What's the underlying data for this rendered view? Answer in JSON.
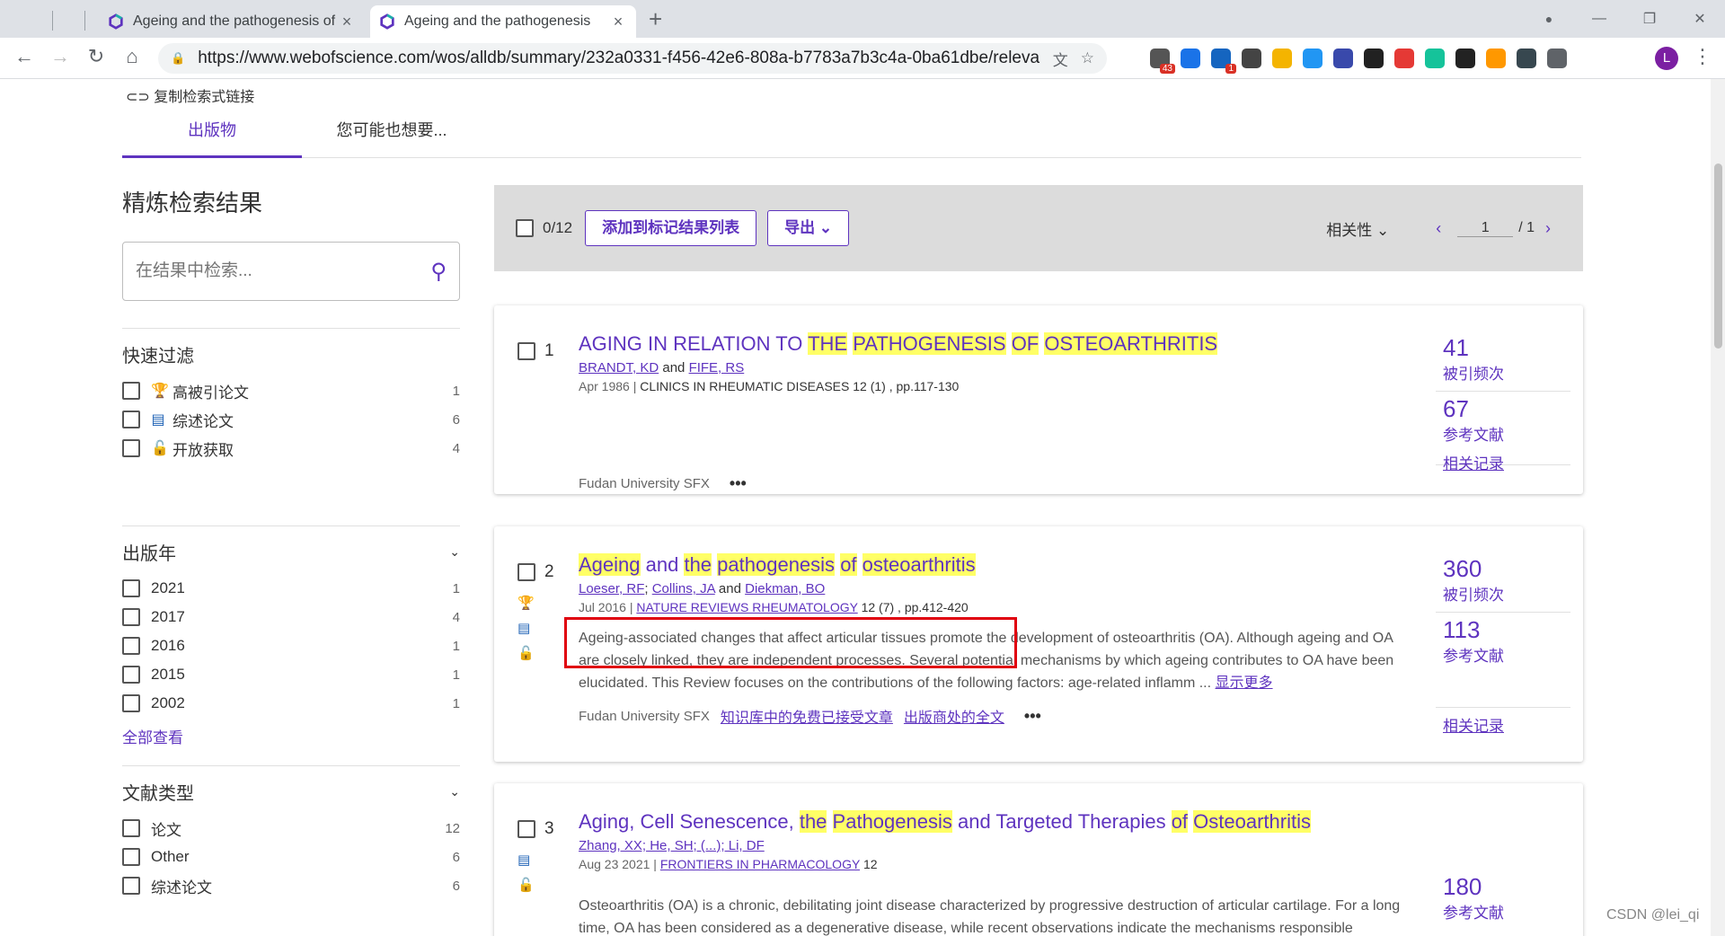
{
  "browser": {
    "tabs": [
      {
        "title": "Ageing and the pathogenesis of",
        "active": false,
        "close": "×"
      },
      {
        "title": "Ageing and the pathogenesis",
        "active": true,
        "close": "×"
      }
    ],
    "new_tab": "+",
    "window_controls": [
      "—",
      "❐",
      "✕"
    ],
    "url": "https://www.webofscience.com/wos/alldb/summary/232a0331-f456-42e6-808a-b7783a7b3c4a-0ba61dbe/releva...",
    "extensions": [
      {
        "name": "grid-extension",
        "color": "#555",
        "badge": "43"
      },
      {
        "name": "vpn-extension",
        "color": "#1a73e8",
        "badge": ""
      },
      {
        "name": "warning-extension",
        "color": "#1565c0",
        "badge": "1"
      },
      {
        "name": "clock-extension",
        "color": "#444",
        "badge": ""
      },
      {
        "name": "folder-extension",
        "color": "#f4b400",
        "badge": ""
      },
      {
        "name": "blue-note-extension",
        "color": "#2196f3",
        "badge": ""
      },
      {
        "name": "star-box-extension",
        "color": "#3949ab",
        "badge": ""
      },
      {
        "name": "face-extension",
        "color": "#212121",
        "badge": ""
      },
      {
        "name": "weibo-extension",
        "color": "#e53935",
        "badge": ""
      },
      {
        "name": "grammarly-extension",
        "color": "#15c39a",
        "badge": ""
      },
      {
        "name": "infinity-extension",
        "color": "#222",
        "badge": ""
      },
      {
        "name": "fish-extension",
        "color": "#ff9800",
        "badge": ""
      },
      {
        "name": "gear-extension",
        "color": "#37474f",
        "badge": ""
      },
      {
        "name": "puzzle-extension",
        "color": "#5f6368",
        "badge": ""
      }
    ],
    "avatar_letter": "L"
  },
  "page": {
    "copy_link": "复制检索式链接",
    "tabs": [
      "出版物",
      "您可能也想要..."
    ],
    "refine": {
      "title": "精炼检索结果",
      "search_placeholder": "在结果中检索...",
      "quick_filter_title": "快速过滤",
      "quick_filters": [
        {
          "label": "高被引论文",
          "count": "1",
          "icon": "trophy-icon"
        },
        {
          "label": "综述论文",
          "count": "6",
          "icon": "document-icon"
        },
        {
          "label": "开放获取",
          "count": "4",
          "icon": "lock-icon"
        }
      ],
      "year_title": "出版年",
      "years": [
        {
          "label": "2021",
          "count": "1"
        },
        {
          "label": "2017",
          "count": "4"
        },
        {
          "label": "2016",
          "count": "1"
        },
        {
          "label": "2015",
          "count": "1"
        },
        {
          "label": "2002",
          "count": "1"
        }
      ],
      "see_all": "全部查看",
      "doctype_title": "文献类型",
      "doctypes": [
        {
          "label": "论文",
          "count": "12"
        },
        {
          "label": "Other",
          "count": "6"
        },
        {
          "label": "综述论文",
          "count": "6"
        }
      ]
    },
    "toolbar": {
      "selected": "0/12",
      "add_to_list": "添加到标记结果列表",
      "export": "导出",
      "sort": "相关性",
      "page": "1",
      "total_pages": "/ 1"
    },
    "results": [
      {
        "index": "1",
        "title_parts": [
          {
            "t": "AGING IN RELATION TO ",
            "h": false
          },
          {
            "t": "THE",
            "h": true
          },
          {
            "t": " ",
            "h": false
          },
          {
            "t": "PATHOGENESIS",
            "h": true
          },
          {
            "t": " ",
            "h": false
          },
          {
            "t": "OF",
            "h": true
          },
          {
            "t": " ",
            "h": false
          },
          {
            "t": "OSTEOARTHRITIS",
            "h": true
          }
        ],
        "authors": [
          "BRANDT, KD",
          "FIFE, RS"
        ],
        "date": "Apr 1986",
        "source": "CLINICS IN RHEUMATIC DISEASES",
        "source_link": false,
        "volume": "12 (1) , pp.117-130",
        "citations": "41",
        "citations_label": "被引频次",
        "references": "67",
        "references_label": "参考文献",
        "sfx": "Fudan University SFX",
        "related": "相关记录"
      },
      {
        "index": "2",
        "title_parts": [
          {
            "t": "Ageing",
            "h": true
          },
          {
            "t": " and ",
            "h": false
          },
          {
            "t": "the",
            "h": true
          },
          {
            "t": " ",
            "h": false
          },
          {
            "t": "pathogenesis",
            "h": true
          },
          {
            "t": " ",
            "h": false
          },
          {
            "t": "of",
            "h": true
          },
          {
            "t": " ",
            "h": false
          },
          {
            "t": "osteoarthritis",
            "h": true
          }
        ],
        "authors": [
          "Loeser, RF",
          "Collins, JA",
          "Diekman, BO"
        ],
        "date": "Jul 2016",
        "source": "NATURE REVIEWS RHEUMATOLOGY",
        "source_link": true,
        "volume": "12 (7) , pp.412-420",
        "abstract": "Ageing-associated changes that affect articular tissues promote the development of osteoarthritis (OA). Although ageing and OA are closely linked, they are independent processes. Several potential mechanisms by which ageing contributes to OA have been elucidated. This Review focuses on the contributions of the following factors: age-related inflamm ...",
        "show_more": "显示更多",
        "citations": "360",
        "citations_label": "被引频次",
        "references": "113",
        "references_label": "参考文献",
        "sfx": "Fudan University SFX",
        "free_link": "知识库中的免费已接受文章",
        "publisher_link": "出版商处的全文",
        "related": "相关记录"
      },
      {
        "index": "3",
        "title_parts": [
          {
            "t": "Aging, Cell Senescence, ",
            "h": false
          },
          {
            "t": "the",
            "h": true
          },
          {
            "t": " ",
            "h": false
          },
          {
            "t": "Pathogenesis",
            "h": true
          },
          {
            "t": " and Targeted Therapies ",
            "h": false
          },
          {
            "t": "of",
            "h": true
          },
          {
            "t": " ",
            "h": false
          },
          {
            "t": "Osteoarthritis",
            "h": true
          }
        ],
        "authors_text": "Zhang, XX; He, SH; (...); Li, DF",
        "date": "Aug 23 2021",
        "source": "FRONTIERS IN PHARMACOLOGY",
        "source_link": true,
        "volume": "12",
        "abstract": "Osteoarthritis (OA) is a chronic, debilitating joint disease characterized by progressive destruction of articular cartilage. For a long time, OA has been considered as a degenerative disease, while recent observations indicate the mechanisms responsible",
        "references": "180",
        "references_label": "参考文献"
      }
    ]
  },
  "watermark": "CSDN @lei_qi",
  "colors": {
    "accent": "#5e33bf",
    "highlight": "#ffff66",
    "annotation": "#e0000e"
  }
}
